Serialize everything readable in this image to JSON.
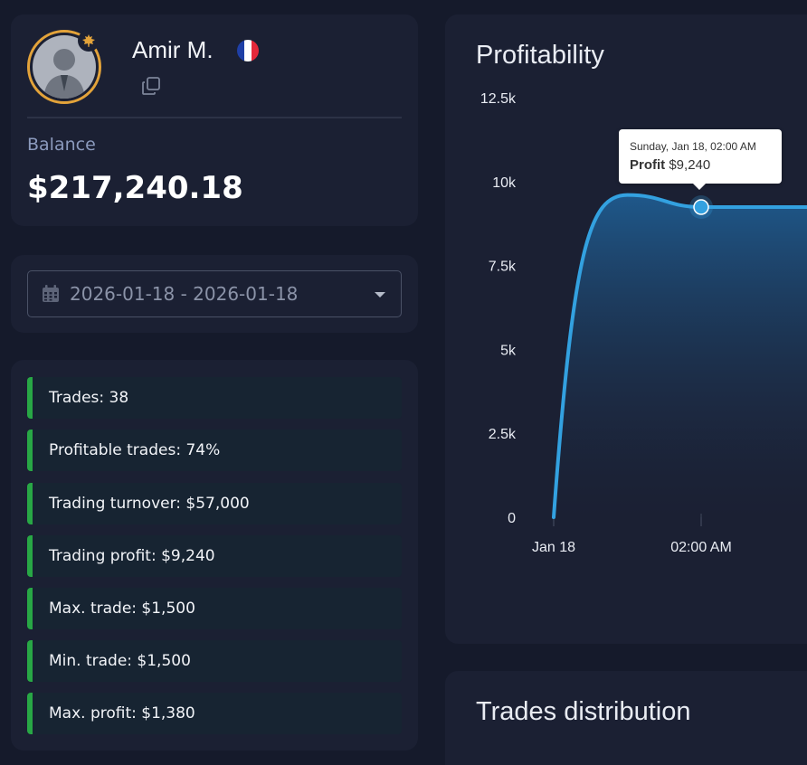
{
  "profile": {
    "name": "Amir M.",
    "avatar_icon": "user-silhouette",
    "badge_icon": "maple-leaf-icon",
    "flag_colors": [
      "#1f3fa6",
      "#ffffff",
      "#e5283a"
    ],
    "balance_label": "Balance",
    "balance_value": "$217,240.18"
  },
  "date_range": {
    "value": "2026-01-18 - 2026-01-18"
  },
  "stats": [
    "Trades: 38",
    "Profitable trades: 74%",
    "Trading turnover: $57,000",
    "Trading profit: $9,240",
    "Max. trade: $1,500",
    "Min. trade: $1,500",
    "Max. profit: $1,380"
  ],
  "profitability": {
    "title": "Profitability",
    "tooltip": {
      "date": "Sunday, Jan 18, 02:00 AM",
      "series_label": "Profit",
      "value": "$9,240"
    }
  },
  "chart_data": {
    "type": "area",
    "title": "Profitability",
    "x_labels": [
      "Jan 18",
      "02:00 AM"
    ],
    "y_ticks": [
      "0",
      "2.5k",
      "5k",
      "7.5k",
      "10k",
      "12.5k"
    ],
    "ylim": [
      0,
      12500
    ],
    "series": [
      {
        "name": "Profit",
        "color": "#33a1e0",
        "points": [
          [
            0,
            0
          ],
          [
            0.5,
            9600
          ],
          [
            1,
            9240
          ],
          [
            1.5,
            9240
          ]
        ]
      }
    ],
    "highlight_index": 2,
    "grid": false
  },
  "distribution": {
    "title": "Trades distribution"
  }
}
